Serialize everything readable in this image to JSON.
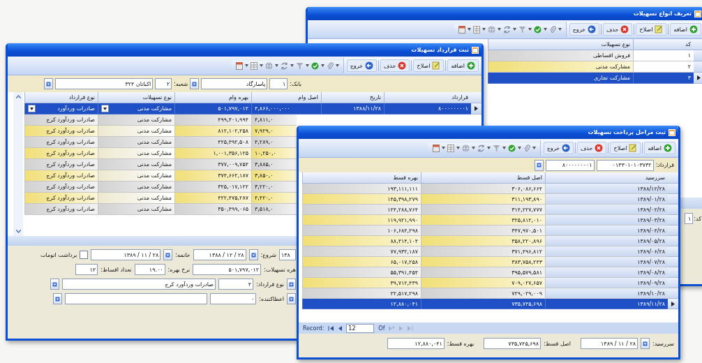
{
  "types_window": {
    "title": "تعریف انواع تسهیلات",
    "toolbar": [
      {
        "kind": "add",
        "label": "اضافه"
      },
      {
        "kind": "edit",
        "label": "اصلاح"
      },
      {
        "kind": "delete",
        "label": "حذف"
      },
      {
        "kind": "exit",
        "label": "خروج"
      }
    ],
    "columns": [
      "کد",
      "نوع تسهیلات"
    ],
    "rows": [
      {
        "code": "۱",
        "name": "فروش اقساطی",
        "selected": false
      },
      {
        "code": "۲",
        "name": "مشارکت مدنی",
        "selected": false
      },
      {
        "code": "۳",
        "name": "مشارکت تجاری",
        "selected": true
      }
    ],
    "code_field": {
      "label": "کد:",
      "value": "۱"
    }
  },
  "contract_window": {
    "title": "ثبت قرارداد تسهیلات",
    "toolbar": [
      {
        "kind": "add",
        "label": "اضافه"
      },
      {
        "kind": "edit",
        "label": "اصلاح"
      },
      {
        "kind": "delete",
        "label": "حذف"
      },
      {
        "kind": "exit",
        "label": "خروج"
      }
    ],
    "bank": {
      "label": "بانک:",
      "code": "۱",
      "name": "پاسارگاد"
    },
    "branch": {
      "label": "شعبه:",
      "code": "۲",
      "name": "اکباتان ۳۲۴"
    },
    "columns": [
      "قرارداد",
      "تاریخ",
      "اصل وام",
      "بهره وام",
      "نوع تسهیلات",
      "نوع قرارداد"
    ],
    "rows": [
      {
        "contract": "۸۰۰۰۰۰۰۰۰۱",
        "date": "۱۳۸۸/۱۱/۲۸",
        "principal": "۴,۸۶۶,۰۰۰,۰۰۰",
        "interest": "۵۰۱,۷۹۷,۰۱۲",
        "facility_type": "مشارکت مدنی",
        "contract_type": "صادرات وردآورد",
        "selected": true
      },
      {
        "principal": "۴,۸۱۱,۰",
        "interest": "۴۹۹,۴۰۱,۹۹۴",
        "facility_type": "مشارکت مدنی",
        "contract_type": "صادرات وردآورد کرج",
        "selected": false
      },
      {
        "principal": "۷,۹۲۹,۰",
        "interest": "۸۱۲,۱۰۲,۲۵۸",
        "facility_type": "مشارکت مدنی",
        "contract_type": "صادرات وردآورد کرج",
        "selected": false
      },
      {
        "principal": "۴,۲۸۹,۰",
        "interest": "۴۲۵,۴۹۲,۵۰۸",
        "facility_type": "مشارکت مدنی",
        "contract_type": "صادرات وردآورد کرج",
        "selected": false
      },
      {
        "principal": "۱۰,۲۵۰,۰",
        "interest": "۱,۰۰۱,۳۵۶,۱۲۵",
        "facility_type": "مشارکت مدنی",
        "contract_type": "صادرات وردآورد کرج",
        "selected": false
      },
      {
        "principal": "۳,۸۸۵,۰",
        "interest": "۳۷۷,۰۰۹,۷۵۴",
        "facility_type": "مشارکت مدنی",
        "contract_type": "صادرات وردآورد کرج",
        "selected": false
      },
      {
        "principal": "۳,۸۵۰,۰",
        "interest": "۳۷۴,۶۶۲,۱۸۷",
        "facility_type": "مشارکت مدنی",
        "contract_type": "صادرات وردآورد کرج",
        "selected": false
      },
      {
        "principal": "۳,۲۲۰,۰",
        "interest": "۳۲۵,۰۱۷,۱۲۲",
        "facility_type": "مشارکت مدنی",
        "contract_type": "صادرات وردآورد کرج",
        "selected": false
      },
      {
        "principal": "۴,۴۲۰,۰",
        "interest": "۴۲۲,۴۷۵,۲۸۷",
        "facility_type": "مشارکت مدنی",
        "contract_type": "صادرات وردآورد کرج",
        "selected": false
      },
      {
        "principal": "۳,۵۱۸,۰",
        "interest": "۳۵۰,۴۹۹,۰۶۵",
        "facility_type": "مشارکت مدنی",
        "contract_type": "صادرات وردآورد کرج",
        "selected": false
      }
    ],
    "form": {
      "date_partial": "۱۳۸",
      "start": {
        "label": "شروع:",
        "value": "۱۳۸۸ / ۱۲ / ۲۸"
      },
      "end": {
        "label": "خاتمه:",
        "value": "۱۳۸۹ / ۱۱ / ۲۸"
      },
      "auto_withdrawal": {
        "label": "برداشت اتومات",
        "checked": false
      },
      "interest": {
        "label": "هره تسهیلات:",
        "value": "۵۰۱,۷۹۷,۰۱۲"
      },
      "rate": {
        "label": "نرخ بهره:",
        "value": "۱۹.۰۰"
      },
      "installments": {
        "label": "تعداد اقساط:",
        "value": "۱۲"
      },
      "contract_type": {
        "label": "نوع قرارداد:",
        "code": "۴",
        "name": "صادرات وردآورد کرج"
      },
      "grantor": {
        "label": "اعطاکننده:",
        "code": "۰"
      }
    }
  },
  "installments_window": {
    "title": "ثبت مراحل پرداخت تسهیلات",
    "toolbar": [
      {
        "kind": "add",
        "label": "اضافه"
      },
      {
        "kind": "edit",
        "label": "اصلاح"
      },
      {
        "kind": "delete",
        "label": "حذف"
      },
      {
        "kind": "exit",
        "label": "خروج"
      }
    ],
    "contract": {
      "label": "قرارداد:",
      "code": "۰۱۳۳۰۱۰۱۰۳۷۳۲",
      "number": "۸۰۰۰۰۰۰۰۰۱"
    },
    "columns": [
      "سررسید",
      "اصل قسط",
      "بهره قسط"
    ],
    "rows": [
      {
        "due": "۱۳۸۸/۱۲/۲۸",
        "principal": "۳۰۶,۰۸۶,۶۶۴",
        "interest": "۱۹۳,۱۱۱,۱۱۱",
        "selected": false
      },
      {
        "due": "۱۳۸۹/۰۱/۲۸",
        "principal": "۳۱۱,۱۹۳,۸۹۰",
        "interest": "۱۴۵,۳۹۸,۲۷۹",
        "selected": false
      },
      {
        "due": "۱۳۸۹/۰۲/۲۸",
        "principal": "۳۱۴,۲۲۷,۷۷۷",
        "interest": "۱۲۴,۲۸۸,۷۶۴",
        "selected": false
      },
      {
        "due": "۱۳۸۹/۰۳/۲۸",
        "principal": "۳۲۵,۸۱۲,۰۱۰",
        "interest": "۱۱۹,۹۲۱,۹۹۰",
        "selected": false
      },
      {
        "due": "۱۳۸۹/۰۴/۲۸",
        "principal": "۳۴۷,۹۷۰,۵۰۱",
        "interest": "۱۰۶,۶۸۴,۲۹۸",
        "selected": false
      },
      {
        "due": "۱۳۸۹/۰۵/۲۸",
        "principal": "۳۵۸,۲۲۰,۸۹۶",
        "interest": "۸۸,۴۱۴,۱۰۴",
        "selected": false
      },
      {
        "due": "۱۳۸۹/۰۶/۲۸",
        "principal": "۳۷۱,۴۹۶,۸۱۲",
        "interest": "۷۷,۹۳۲,۱۸۷",
        "selected": false
      },
      {
        "due": "۱۳۸۹/۰۷/۲۸",
        "principal": "۳۸۳,۷۵۸,۲۴۳",
        "interest": "۶۵,۰۱۷,۲۵۸",
        "selected": false
      },
      {
        "due": "۱۳۸۹/۰۸/۲۸",
        "principal": "۳۹۵,۵۷۹,۵۸۱",
        "interest": "۵۵,۳۹۱,۴۵۴",
        "selected": false
      },
      {
        "due": "۱۳۸۹/۰۹/۲۸",
        "principal": "۷۰۹,۰۲۷,۶۵۷",
        "interest": "۳۹,۷۱۲,۴۳۹",
        "selected": false
      },
      {
        "due": "۱۳۸۹/۱۰/۲۸",
        "principal": "۷۲۹,۰۲۹,۰۰۹",
        "interest": "۲۲,۵۱۷,۲۹۸",
        "selected": false
      },
      {
        "due": "۱۳۸۹/۱۱/۲۸",
        "principal": "۷۳۵,۷۴۵,۶۹۸",
        "interest": "۱۲,۸۸۰,۰۴۱",
        "selected": true
      }
    ],
    "navigator": {
      "label": "Record:",
      "current": "12",
      "of": "Of"
    },
    "form": {
      "due": {
        "label": "سررسید:",
        "value": "۱۳۸۹ / ۱۱ / ۲۸"
      },
      "principal": {
        "label": "اصل قسط:",
        "value": "۷۳۵,۷۴۵,۶۹۸"
      },
      "interest": {
        "label": "بهره قسط:",
        "value": "۱۲,۸۸۰,۰۴۱"
      }
    }
  }
}
